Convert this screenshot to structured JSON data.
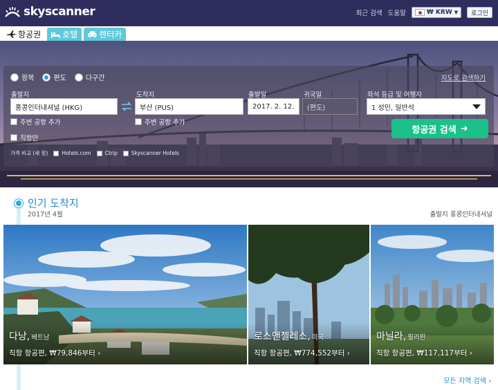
{
  "header": {
    "brand": "skyscanner",
    "links": {
      "recent": "최근 검색",
      "help": "도움말"
    },
    "currency": "₩ KRW",
    "login": "로그인"
  },
  "tabs": [
    {
      "label": "항공권",
      "icon": "airplane-icon",
      "active": true
    },
    {
      "label": "호텔",
      "icon": "bed-icon",
      "active": false
    },
    {
      "label": "렌터카",
      "icon": "car-icon",
      "active": false
    }
  ],
  "search": {
    "trip_types": [
      {
        "label": "왕복",
        "selected": false
      },
      {
        "label": "편도",
        "selected": true
      },
      {
        "label": "다구간",
        "selected": false
      }
    ],
    "map_link": "지도로 검색하기",
    "from": {
      "label": "출발지",
      "value": "홍콩인터내셔널 (HKG)",
      "nearby": "주변 공항 추가"
    },
    "to": {
      "label": "도착지",
      "value": "부산 (PUS)",
      "nearby": "주변 공항 추가"
    },
    "depart": {
      "label": "출발일",
      "value": "2017. 2. 12."
    },
    "return": {
      "label": "귀국일",
      "value": "(편도)"
    },
    "cabin": {
      "label": "좌석 등급 및 여행자",
      "value": "1 성인, 일반석"
    },
    "direct_only": "직항만",
    "search_button": "항공권 검색",
    "compare_label": "가격 비교 (새 창)",
    "compare_options": [
      "Hotels.com",
      "Ctrip",
      "Skyscanner Hotels"
    ]
  },
  "popular": {
    "title": "인기 도착지",
    "date": "2017년 4월",
    "origin": "출발지 홍콩인터내셔널",
    "all_regions": "모든 지역 검색",
    "destinations": [
      {
        "city": "다낭,",
        "country": "베트남",
        "price": "직항 항공편, ₩79,846부터"
      },
      {
        "city": "로스앤젤레스,",
        "country": "미국",
        "price": "직항 항공편, ₩774,552부터"
      },
      {
        "city": "마닐라,",
        "country": "필리핀",
        "price": "직항 항공편, ₩117,117부터"
      }
    ]
  },
  "colors": {
    "header_bg": "#2e2d5e",
    "tab_inactive": "#5ec9d8",
    "search_button": "#1cc189",
    "link_blue": "#1e8ad0"
  }
}
